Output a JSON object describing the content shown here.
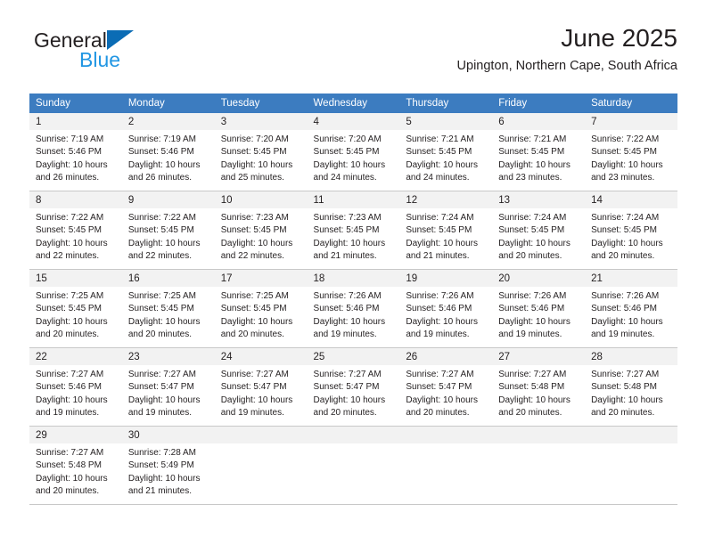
{
  "brand": {
    "name_top": "General",
    "name_bottom": "Blue",
    "triangle_color": "#0b6cb5",
    "blue_color": "#2196e3"
  },
  "header": {
    "title": "June 2025",
    "subtitle": "Upington, Northern Cape, South Africa"
  },
  "theme": {
    "header_bg": "#3c7cc0",
    "header_text": "#ffffff",
    "daynum_bg": "#f2f2f2",
    "grid_line": "#c8c8c8"
  },
  "calendar": {
    "weekday_headers": [
      "Sunday",
      "Monday",
      "Tuesday",
      "Wednesday",
      "Thursday",
      "Friday",
      "Saturday"
    ],
    "weeks": [
      [
        {
          "day": "1",
          "sunrise": "Sunrise: 7:19 AM",
          "sunset": "Sunset: 5:46 PM",
          "daylight": "Daylight: 10 hours and 26 minutes."
        },
        {
          "day": "2",
          "sunrise": "Sunrise: 7:19 AM",
          "sunset": "Sunset: 5:46 PM",
          "daylight": "Daylight: 10 hours and 26 minutes."
        },
        {
          "day": "3",
          "sunrise": "Sunrise: 7:20 AM",
          "sunset": "Sunset: 5:45 PM",
          "daylight": "Daylight: 10 hours and 25 minutes."
        },
        {
          "day": "4",
          "sunrise": "Sunrise: 7:20 AM",
          "sunset": "Sunset: 5:45 PM",
          "daylight": "Daylight: 10 hours and 24 minutes."
        },
        {
          "day": "5",
          "sunrise": "Sunrise: 7:21 AM",
          "sunset": "Sunset: 5:45 PM",
          "daylight": "Daylight: 10 hours and 24 minutes."
        },
        {
          "day": "6",
          "sunrise": "Sunrise: 7:21 AM",
          "sunset": "Sunset: 5:45 PM",
          "daylight": "Daylight: 10 hours and 23 minutes."
        },
        {
          "day": "7",
          "sunrise": "Sunrise: 7:22 AM",
          "sunset": "Sunset: 5:45 PM",
          "daylight": "Daylight: 10 hours and 23 minutes."
        }
      ],
      [
        {
          "day": "8",
          "sunrise": "Sunrise: 7:22 AM",
          "sunset": "Sunset: 5:45 PM",
          "daylight": "Daylight: 10 hours and 22 minutes."
        },
        {
          "day": "9",
          "sunrise": "Sunrise: 7:22 AM",
          "sunset": "Sunset: 5:45 PM",
          "daylight": "Daylight: 10 hours and 22 minutes."
        },
        {
          "day": "10",
          "sunrise": "Sunrise: 7:23 AM",
          "sunset": "Sunset: 5:45 PM",
          "daylight": "Daylight: 10 hours and 22 minutes."
        },
        {
          "day": "11",
          "sunrise": "Sunrise: 7:23 AM",
          "sunset": "Sunset: 5:45 PM",
          "daylight": "Daylight: 10 hours and 21 minutes."
        },
        {
          "day": "12",
          "sunrise": "Sunrise: 7:24 AM",
          "sunset": "Sunset: 5:45 PM",
          "daylight": "Daylight: 10 hours and 21 minutes."
        },
        {
          "day": "13",
          "sunrise": "Sunrise: 7:24 AM",
          "sunset": "Sunset: 5:45 PM",
          "daylight": "Daylight: 10 hours and 20 minutes."
        },
        {
          "day": "14",
          "sunrise": "Sunrise: 7:24 AM",
          "sunset": "Sunset: 5:45 PM",
          "daylight": "Daylight: 10 hours and 20 minutes."
        }
      ],
      [
        {
          "day": "15",
          "sunrise": "Sunrise: 7:25 AM",
          "sunset": "Sunset: 5:45 PM",
          "daylight": "Daylight: 10 hours and 20 minutes."
        },
        {
          "day": "16",
          "sunrise": "Sunrise: 7:25 AM",
          "sunset": "Sunset: 5:45 PM",
          "daylight": "Daylight: 10 hours and 20 minutes."
        },
        {
          "day": "17",
          "sunrise": "Sunrise: 7:25 AM",
          "sunset": "Sunset: 5:45 PM",
          "daylight": "Daylight: 10 hours and 20 minutes."
        },
        {
          "day": "18",
          "sunrise": "Sunrise: 7:26 AM",
          "sunset": "Sunset: 5:46 PM",
          "daylight": "Daylight: 10 hours and 19 minutes."
        },
        {
          "day": "19",
          "sunrise": "Sunrise: 7:26 AM",
          "sunset": "Sunset: 5:46 PM",
          "daylight": "Daylight: 10 hours and 19 minutes."
        },
        {
          "day": "20",
          "sunrise": "Sunrise: 7:26 AM",
          "sunset": "Sunset: 5:46 PM",
          "daylight": "Daylight: 10 hours and 19 minutes."
        },
        {
          "day": "21",
          "sunrise": "Sunrise: 7:26 AM",
          "sunset": "Sunset: 5:46 PM",
          "daylight": "Daylight: 10 hours and 19 minutes."
        }
      ],
      [
        {
          "day": "22",
          "sunrise": "Sunrise: 7:27 AM",
          "sunset": "Sunset: 5:46 PM",
          "daylight": "Daylight: 10 hours and 19 minutes."
        },
        {
          "day": "23",
          "sunrise": "Sunrise: 7:27 AM",
          "sunset": "Sunset: 5:47 PM",
          "daylight": "Daylight: 10 hours and 19 minutes."
        },
        {
          "day": "24",
          "sunrise": "Sunrise: 7:27 AM",
          "sunset": "Sunset: 5:47 PM",
          "daylight": "Daylight: 10 hours and 19 minutes."
        },
        {
          "day": "25",
          "sunrise": "Sunrise: 7:27 AM",
          "sunset": "Sunset: 5:47 PM",
          "daylight": "Daylight: 10 hours and 20 minutes."
        },
        {
          "day": "26",
          "sunrise": "Sunrise: 7:27 AM",
          "sunset": "Sunset: 5:47 PM",
          "daylight": "Daylight: 10 hours and 20 minutes."
        },
        {
          "day": "27",
          "sunrise": "Sunrise: 7:27 AM",
          "sunset": "Sunset: 5:48 PM",
          "daylight": "Daylight: 10 hours and 20 minutes."
        },
        {
          "day": "28",
          "sunrise": "Sunrise: 7:27 AM",
          "sunset": "Sunset: 5:48 PM",
          "daylight": "Daylight: 10 hours and 20 minutes."
        }
      ],
      [
        {
          "day": "29",
          "sunrise": "Sunrise: 7:27 AM",
          "sunset": "Sunset: 5:48 PM",
          "daylight": "Daylight: 10 hours and 20 minutes."
        },
        {
          "day": "30",
          "sunrise": "Sunrise: 7:28 AM",
          "sunset": "Sunset: 5:49 PM",
          "daylight": "Daylight: 10 hours and 21 minutes."
        },
        {
          "day": "",
          "sunrise": "",
          "sunset": "",
          "daylight": ""
        },
        {
          "day": "",
          "sunrise": "",
          "sunset": "",
          "daylight": ""
        },
        {
          "day": "",
          "sunrise": "",
          "sunset": "",
          "daylight": ""
        },
        {
          "day": "",
          "sunrise": "",
          "sunset": "",
          "daylight": ""
        },
        {
          "day": "",
          "sunrise": "",
          "sunset": "",
          "daylight": ""
        }
      ]
    ]
  }
}
